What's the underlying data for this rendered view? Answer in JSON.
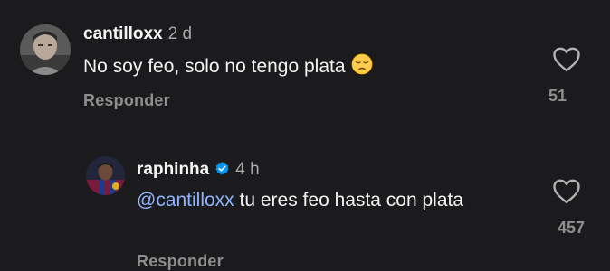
{
  "comments": [
    {
      "username": "cantilloxx",
      "time": "2 d",
      "text": "No soy feo, solo no tengo plata",
      "emoji": "pensive-face",
      "reply_label": "Responder",
      "likes": "51",
      "verified": false
    }
  ],
  "reply": {
    "username": "raphinha",
    "time": "4 h",
    "verified": true,
    "mention": "@cantilloxx",
    "text": " tu eres feo hasta con plata",
    "reply_label": "Responder",
    "likes": "457"
  },
  "colors": {
    "background": "#1b1b1d",
    "text": "#f5f5f5",
    "muted": "#8e8e8e",
    "mention": "#8fb4ff",
    "verified": "#0095f6"
  },
  "icons": {
    "like": "heart-outline-icon",
    "verified": "verified-badge-icon"
  }
}
